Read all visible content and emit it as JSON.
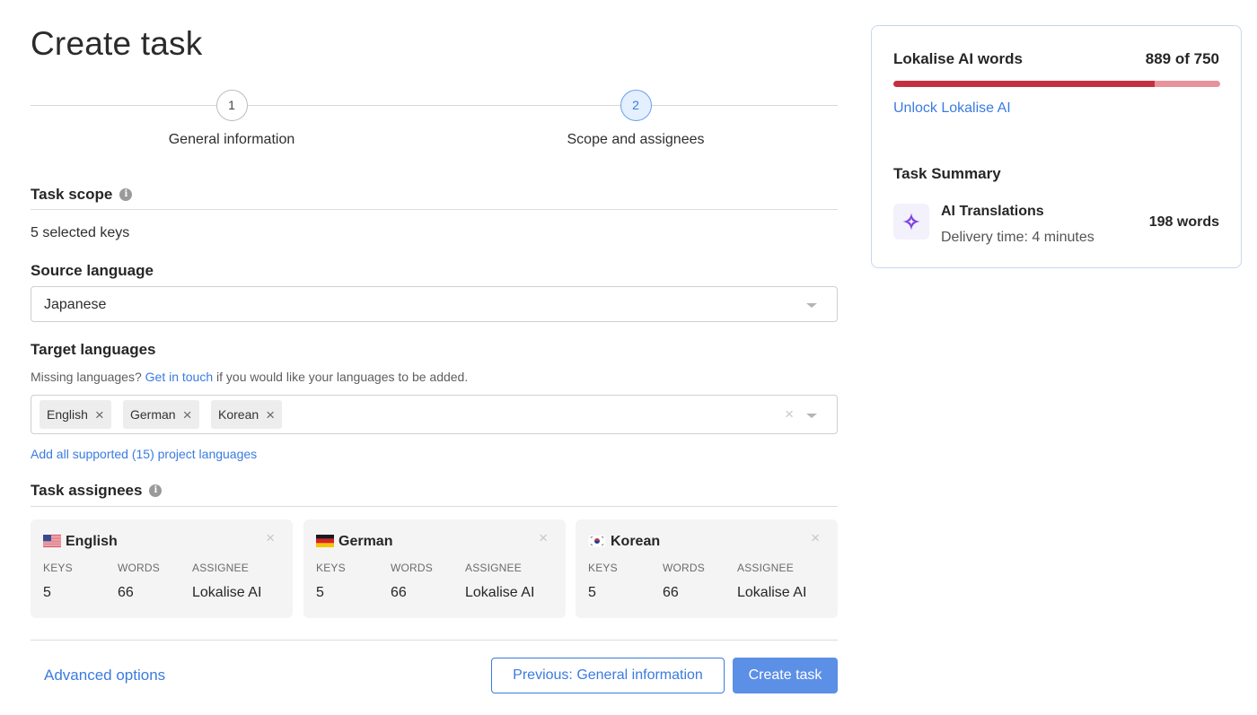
{
  "page": {
    "title": "Create task"
  },
  "stepper": {
    "steps": [
      {
        "number": "1",
        "label": "General information",
        "state": "completed"
      },
      {
        "number": "2",
        "label": "Scope and assignees",
        "state": "active"
      }
    ]
  },
  "task_scope": {
    "title": "Task scope",
    "info_icon": "info-icon",
    "value": "5 selected keys"
  },
  "source_language": {
    "title": "Source language",
    "selected": "Japanese"
  },
  "target_languages": {
    "title": "Target languages",
    "hint_prefix": "Missing languages?",
    "hint_link": "Get in touch",
    "hint_suffix": "if you would like your languages to be added.",
    "chips": [
      {
        "label": "English"
      },
      {
        "label": "German"
      },
      {
        "label": "Korean"
      }
    ],
    "add_all_link": "Add all supported (15) project languages"
  },
  "assignees": {
    "title": "Task assignees",
    "info_icon": "info-icon",
    "columns": {
      "keys": "KEYS",
      "words": "WORDS",
      "assignee": "ASSIGNEE"
    },
    "cards": [
      {
        "language": "English",
        "flag": "us-flag-icon",
        "keys": "5",
        "words": "66",
        "assignee": "Lokalise AI"
      },
      {
        "language": "German",
        "flag": "de-flag-icon",
        "keys": "5",
        "words": "66",
        "assignee": "Lokalise AI"
      },
      {
        "language": "Korean",
        "flag": "kr-flag-icon",
        "keys": "5",
        "words": "66",
        "assignee": "Lokalise AI"
      }
    ]
  },
  "footer": {
    "advanced_options": "Advanced options",
    "previous_button": "Previous: General information",
    "create_button": "Create task"
  },
  "sidebar": {
    "ai_words_title": "Lokalise AI words",
    "ai_words_count": "889 of 750",
    "ai_words_used_fraction": 0.8,
    "unlock_link": "Unlock Lokalise AI",
    "summary_title": "Task Summary",
    "summary_item": {
      "icon": "ai-sparkle-icon",
      "name": "AI Translations",
      "delivery": "Delivery time: 4 minutes",
      "words": "198 words"
    }
  },
  "colors": {
    "accent": "#3b7be0",
    "primary_button": "#5c8fe6",
    "progress_used": "#c4303f",
    "progress_over": "#e8929c",
    "ai_icon": "#7b3fe4"
  }
}
